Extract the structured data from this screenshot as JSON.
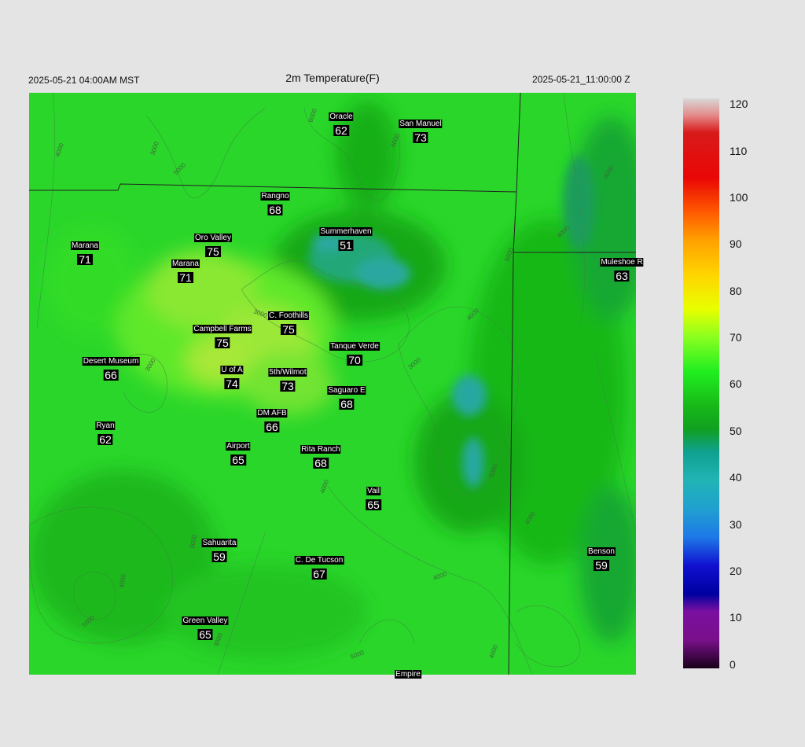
{
  "header": {
    "local_time": "2025-05-21 04:00AM MST",
    "title": "2m Temperature(F)",
    "valid_time": "2025-05-21_11:00:00 Z"
  },
  "colorbar": {
    "ticks": [
      "120",
      "110",
      "100",
      "90",
      "80",
      "70",
      "60",
      "50",
      "40",
      "30",
      "20",
      "10",
      "0"
    ],
    "min": 0,
    "max": 120
  },
  "contour_labels": [
    "4000",
    "3000",
    "5000",
    "6000",
    "3000",
    "4000",
    "6000",
    "5000",
    "4000",
    "3000",
    "4000",
    "3000",
    "5000",
    "4000",
    "4000",
    "4000",
    "3000",
    "5000",
    "4000",
    "5000",
    "3000",
    "4000"
  ],
  "stations": [
    {
      "name": "Oracle",
      "value": "62"
    },
    {
      "name": "San Manuel",
      "value": "73"
    },
    {
      "name": "Rangno",
      "value": "68"
    },
    {
      "name": "Summerhaven",
      "value": "51"
    },
    {
      "name": "Marana",
      "value": "71"
    },
    {
      "name": "Oro Valley",
      "value": "75"
    },
    {
      "name": "Marana",
      "value": "71"
    },
    {
      "name": "Muleshoe R",
      "value": "63"
    },
    {
      "name": "C. Foothills",
      "value": "75"
    },
    {
      "name": "Campbell Farms",
      "value": "75"
    },
    {
      "name": "Tanque Verde",
      "value": "70"
    },
    {
      "name": "Desert Museum",
      "value": "66"
    },
    {
      "name": "U of A",
      "value": "74"
    },
    {
      "name": "5th/Wilmot",
      "value": "73"
    },
    {
      "name": "Saguaro E",
      "value": "68"
    },
    {
      "name": "DM AFB",
      "value": "66"
    },
    {
      "name": "Ryan",
      "value": "62"
    },
    {
      "name": "Airport",
      "value": "65"
    },
    {
      "name": "Rita Ranch",
      "value": "68"
    },
    {
      "name": "Vail",
      "value": "65"
    },
    {
      "name": "Benson",
      "value": "59"
    },
    {
      "name": "Sahuarita",
      "value": "59"
    },
    {
      "name": "C. De Tucson",
      "value": "67"
    },
    {
      "name": "Green Valley",
      "value": "65"
    },
    {
      "name": "Empire",
      "value": ""
    }
  ]
}
